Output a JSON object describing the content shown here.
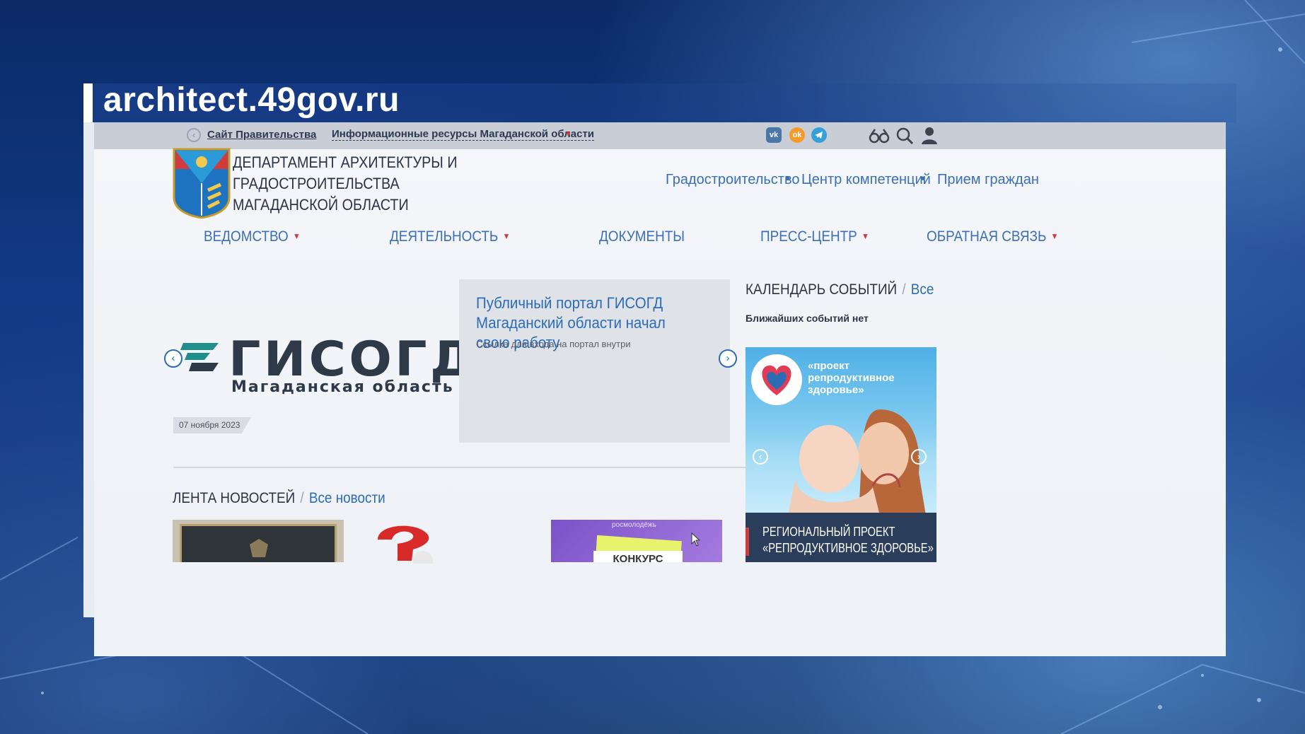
{
  "caption": {
    "url": "architect.49gov.ru"
  },
  "topbar": {
    "gov_site_link": "Сайт Правительства",
    "info_resources": "Информационные ресурсы Магаданской области",
    "social": [
      "vk-icon",
      "odnoklassniki-icon",
      "telegram-icon"
    ],
    "tools": [
      "accessibility-glasses-icon",
      "search-icon",
      "user-icon"
    ]
  },
  "header": {
    "title_lines": [
      "ДЕПАРТАМЕНТ АРХИТЕКТУРЫ И",
      "ГРАДОСТРОИТЕЛЬСТВА",
      "МАГАДАНСКОЙ ОБЛАСТИ"
    ],
    "quick_links": [
      "Градостроительство",
      "Центр компетенций",
      "Прием граждан"
    ]
  },
  "nav": {
    "items": [
      {
        "label": "ВЕДОМСТВО",
        "dropdown": true
      },
      {
        "label": "ДЕЯТЕЛЬНОСТЬ",
        "dropdown": true
      },
      {
        "label": "ДОКУМЕНТЫ",
        "dropdown": false
      },
      {
        "label": "ПРЕСС-ЦЕНТР",
        "dropdown": true
      },
      {
        "label": "ОБРАТНАЯ СВЯЗЬ",
        "dropdown": true
      }
    ]
  },
  "slider": {
    "logo_word": "ГИСОГД",
    "logo_sub": "Магаданская область",
    "date": "07 ноября 2023",
    "headline": "Публичный портал ГИСОГД Магаданский области начал свою работу",
    "subtext": "Ссылка для входа на портал внутри"
  },
  "calendar": {
    "title": "КАЛЕНДАРЬ СОБЫТИЙ",
    "all_link": "Все",
    "empty_text": "Ближайших событий нет"
  },
  "news": {
    "title": "ЛЕНТА НОВОСТЕЙ",
    "all_link": "Все новости",
    "thumb3_top": "росмолодёжь",
    "thumb3_text": "КОНКУРС"
  },
  "banner": {
    "image_text": "«проект репродуктивное здоровье»",
    "caption_lines": [
      "РЕГИОНАЛЬНЫЙ ПРОЕКТ",
      "«РЕПРОДУКТИВНОЕ ЗДОРОВЬЕ»"
    ]
  },
  "colors": {
    "link": "#2c6cb5",
    "accent_red": "#d23b3b",
    "logo_teal": "#1f8f8c",
    "logo_dark": "#2f3a48"
  }
}
